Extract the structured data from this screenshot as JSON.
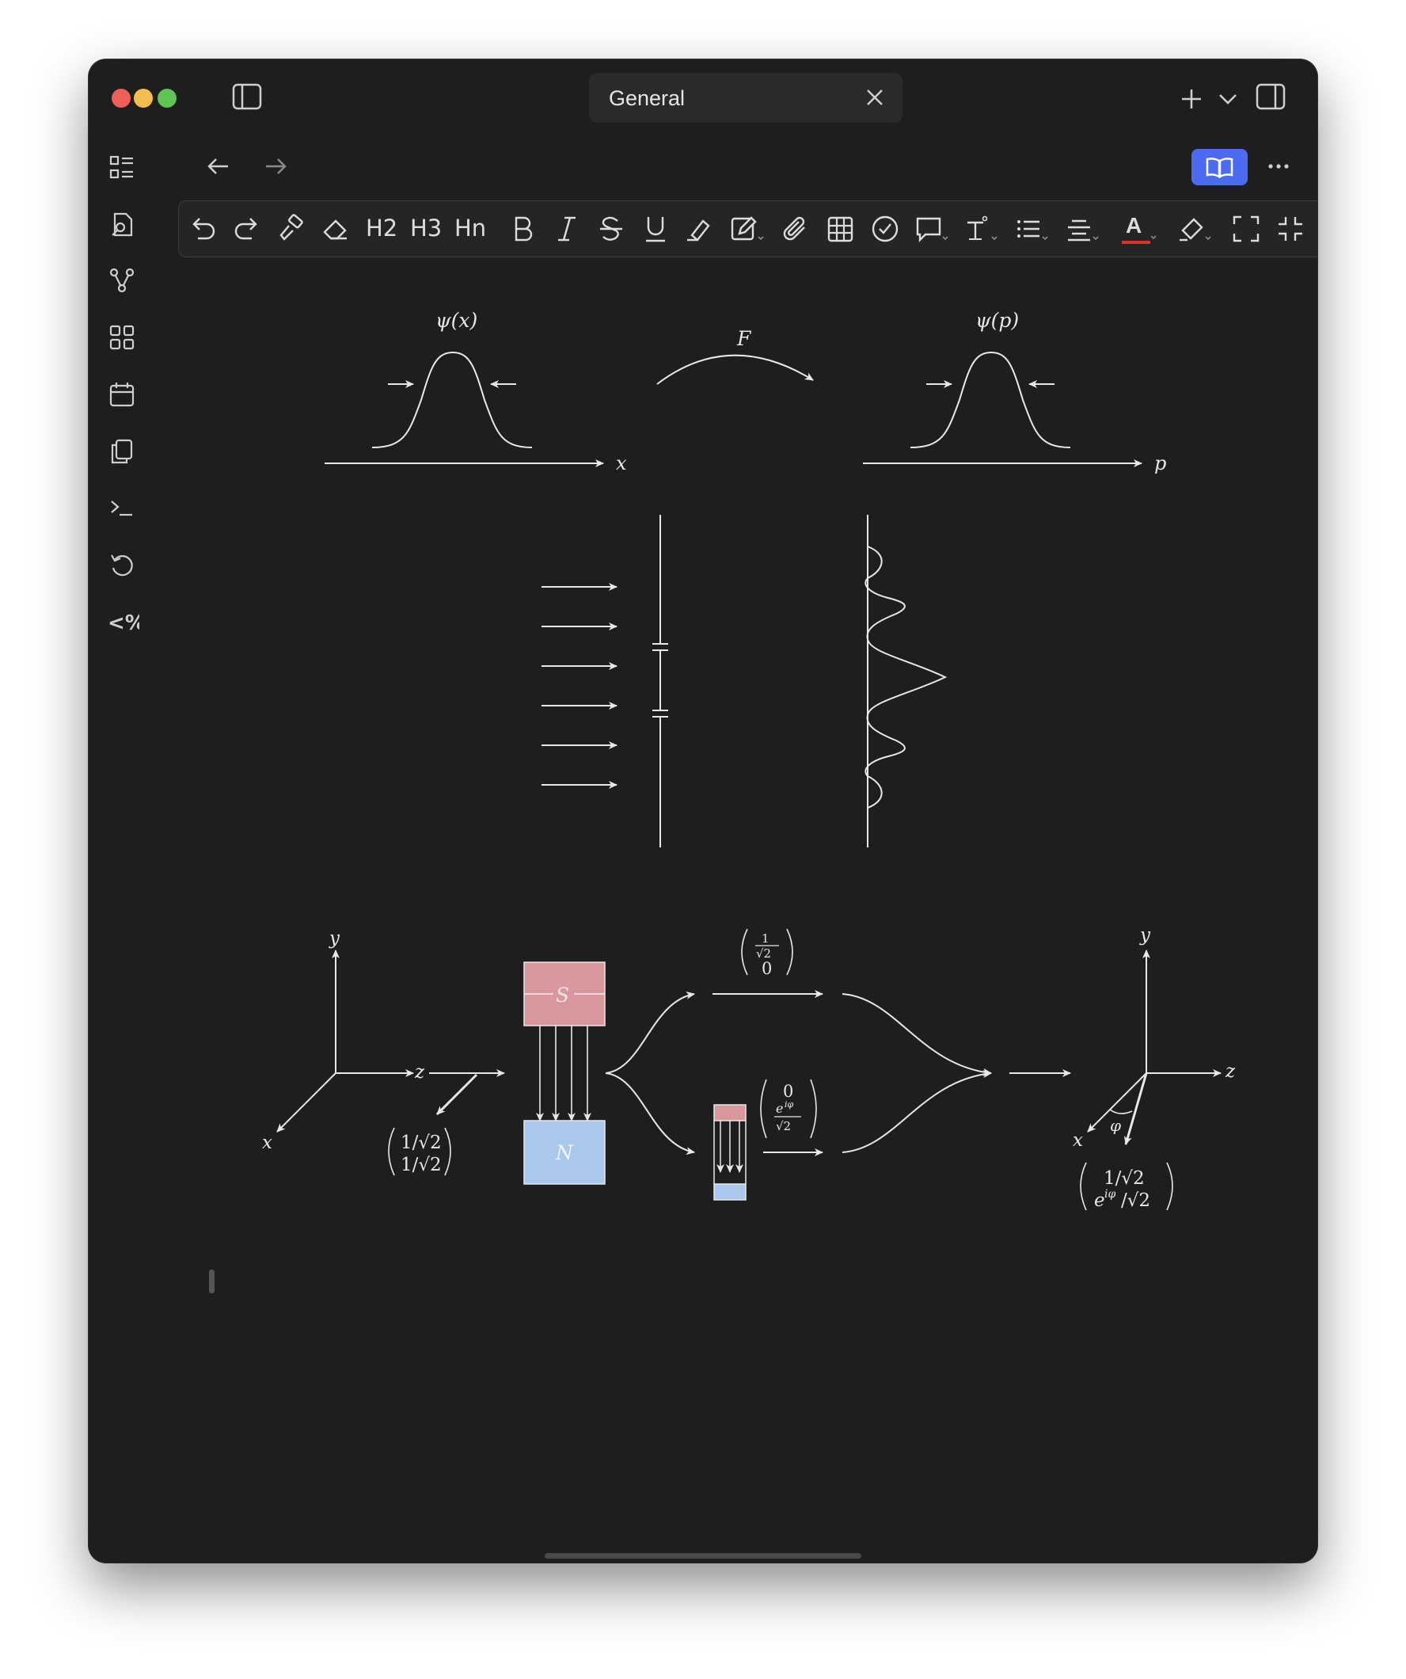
{
  "tab": {
    "title": "General"
  },
  "toolbar": {
    "h2": "H2",
    "h3": "H3",
    "hn": "Hn",
    "text_color_letter": "A",
    "text_color_underline": "#e03030"
  },
  "colors": {
    "accent": "#4b6bf0",
    "magnet_south": "#d9979e",
    "magnet_north": "#a9c8ec"
  },
  "diagram": {
    "psi_x": "ψ(x)",
    "psi_p": "ψ(p)",
    "fourier": "F",
    "axis_x": "x",
    "axis_p": "p",
    "axis_y1": "y",
    "axis_z1": "z",
    "axis_x1": "x",
    "state_in_top": "1/√2",
    "state_in_bottom": "1/√2",
    "magnet_s": "S",
    "magnet_n": "N",
    "state_up_top": "1",
    "state_up_den": "√2",
    "state_up_bottom": "0",
    "state_down_top": "0",
    "state_down_num": "e",
    "state_down_sup": "iφ",
    "state_down_den": "√2",
    "axis_y2": "y",
    "axis_z2": "z",
    "axis_x2": "x",
    "angle_phi": "φ",
    "state_out_top": "1/√2",
    "state_out_bottom_e": "e",
    "state_out_bottom_sup": "iφ",
    "state_out_bottom_rest": "/√2"
  }
}
